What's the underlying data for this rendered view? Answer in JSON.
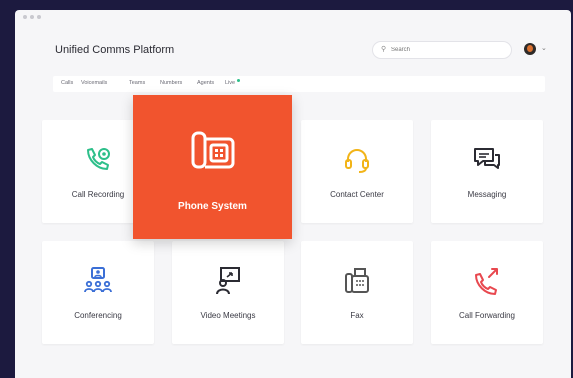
{
  "app": {
    "title": "Unified Comms Platform"
  },
  "search": {
    "placeholder": "Search",
    "icon": "search-icon"
  },
  "nav": {
    "items": [
      {
        "label": "Calls"
      },
      {
        "label": "Voicemails"
      },
      {
        "label": "Teams"
      },
      {
        "label": "Numbers"
      },
      {
        "label": "Agents"
      },
      {
        "label": "Live"
      }
    ]
  },
  "tiles": {
    "call_recording": {
      "label": "Call Recording",
      "icon": "call-recording-icon"
    },
    "phone_system": {
      "label": "Phone System",
      "icon": "desk-phone-icon"
    },
    "contact_center": {
      "label": "Contact Center",
      "icon": "headset-icon"
    },
    "messaging": {
      "label": "Messaging",
      "icon": "chat-bubbles-icon"
    },
    "conferencing": {
      "label": "Conferencing",
      "icon": "conference-icon"
    },
    "video_meetings": {
      "label": "Video Meetings",
      "icon": "video-presenter-icon"
    },
    "fax": {
      "label": "Fax",
      "icon": "fax-icon"
    },
    "call_forwarding": {
      "label": "Call Forwarding",
      "icon": "call-forward-icon"
    }
  },
  "colors": {
    "accent": "#f1542e",
    "green": "#2dbf8a",
    "yellow": "#f2b418",
    "blue": "#3b6fd6",
    "red": "#e8484f",
    "dark": "#2b2b33"
  }
}
